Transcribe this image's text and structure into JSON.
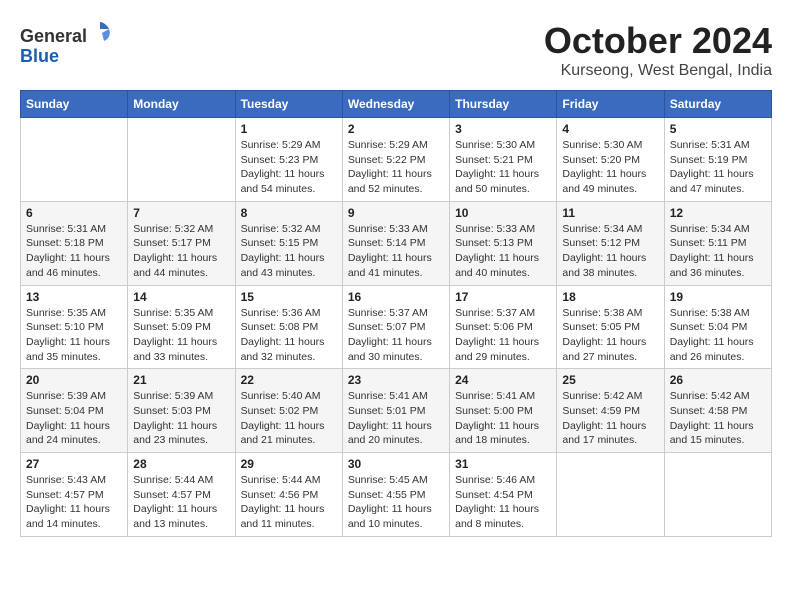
{
  "header": {
    "logo_line1": "General",
    "logo_line2": "Blue",
    "month_title": "October 2024",
    "location": "Kurseong, West Bengal, India"
  },
  "days_of_week": [
    "Sunday",
    "Monday",
    "Tuesday",
    "Wednesday",
    "Thursday",
    "Friday",
    "Saturday"
  ],
  "weeks": [
    [
      {
        "day": "",
        "sunrise": "",
        "sunset": "",
        "daylight": ""
      },
      {
        "day": "",
        "sunrise": "",
        "sunset": "",
        "daylight": ""
      },
      {
        "day": "1",
        "sunrise": "Sunrise: 5:29 AM",
        "sunset": "Sunset: 5:23 PM",
        "daylight": "Daylight: 11 hours and 54 minutes."
      },
      {
        "day": "2",
        "sunrise": "Sunrise: 5:29 AM",
        "sunset": "Sunset: 5:22 PM",
        "daylight": "Daylight: 11 hours and 52 minutes."
      },
      {
        "day": "3",
        "sunrise": "Sunrise: 5:30 AM",
        "sunset": "Sunset: 5:21 PM",
        "daylight": "Daylight: 11 hours and 50 minutes."
      },
      {
        "day": "4",
        "sunrise": "Sunrise: 5:30 AM",
        "sunset": "Sunset: 5:20 PM",
        "daylight": "Daylight: 11 hours and 49 minutes."
      },
      {
        "day": "5",
        "sunrise": "Sunrise: 5:31 AM",
        "sunset": "Sunset: 5:19 PM",
        "daylight": "Daylight: 11 hours and 47 minutes."
      }
    ],
    [
      {
        "day": "6",
        "sunrise": "Sunrise: 5:31 AM",
        "sunset": "Sunset: 5:18 PM",
        "daylight": "Daylight: 11 hours and 46 minutes."
      },
      {
        "day": "7",
        "sunrise": "Sunrise: 5:32 AM",
        "sunset": "Sunset: 5:17 PM",
        "daylight": "Daylight: 11 hours and 44 minutes."
      },
      {
        "day": "8",
        "sunrise": "Sunrise: 5:32 AM",
        "sunset": "Sunset: 5:15 PM",
        "daylight": "Daylight: 11 hours and 43 minutes."
      },
      {
        "day": "9",
        "sunrise": "Sunrise: 5:33 AM",
        "sunset": "Sunset: 5:14 PM",
        "daylight": "Daylight: 11 hours and 41 minutes."
      },
      {
        "day": "10",
        "sunrise": "Sunrise: 5:33 AM",
        "sunset": "Sunset: 5:13 PM",
        "daylight": "Daylight: 11 hours and 40 minutes."
      },
      {
        "day": "11",
        "sunrise": "Sunrise: 5:34 AM",
        "sunset": "Sunset: 5:12 PM",
        "daylight": "Daylight: 11 hours and 38 minutes."
      },
      {
        "day": "12",
        "sunrise": "Sunrise: 5:34 AM",
        "sunset": "Sunset: 5:11 PM",
        "daylight": "Daylight: 11 hours and 36 minutes."
      }
    ],
    [
      {
        "day": "13",
        "sunrise": "Sunrise: 5:35 AM",
        "sunset": "Sunset: 5:10 PM",
        "daylight": "Daylight: 11 hours and 35 minutes."
      },
      {
        "day": "14",
        "sunrise": "Sunrise: 5:35 AM",
        "sunset": "Sunset: 5:09 PM",
        "daylight": "Daylight: 11 hours and 33 minutes."
      },
      {
        "day": "15",
        "sunrise": "Sunrise: 5:36 AM",
        "sunset": "Sunset: 5:08 PM",
        "daylight": "Daylight: 11 hours and 32 minutes."
      },
      {
        "day": "16",
        "sunrise": "Sunrise: 5:37 AM",
        "sunset": "Sunset: 5:07 PM",
        "daylight": "Daylight: 11 hours and 30 minutes."
      },
      {
        "day": "17",
        "sunrise": "Sunrise: 5:37 AM",
        "sunset": "Sunset: 5:06 PM",
        "daylight": "Daylight: 11 hours and 29 minutes."
      },
      {
        "day": "18",
        "sunrise": "Sunrise: 5:38 AM",
        "sunset": "Sunset: 5:05 PM",
        "daylight": "Daylight: 11 hours and 27 minutes."
      },
      {
        "day": "19",
        "sunrise": "Sunrise: 5:38 AM",
        "sunset": "Sunset: 5:04 PM",
        "daylight": "Daylight: 11 hours and 26 minutes."
      }
    ],
    [
      {
        "day": "20",
        "sunrise": "Sunrise: 5:39 AM",
        "sunset": "Sunset: 5:04 PM",
        "daylight": "Daylight: 11 hours and 24 minutes."
      },
      {
        "day": "21",
        "sunrise": "Sunrise: 5:39 AM",
        "sunset": "Sunset: 5:03 PM",
        "daylight": "Daylight: 11 hours and 23 minutes."
      },
      {
        "day": "22",
        "sunrise": "Sunrise: 5:40 AM",
        "sunset": "Sunset: 5:02 PM",
        "daylight": "Daylight: 11 hours and 21 minutes."
      },
      {
        "day": "23",
        "sunrise": "Sunrise: 5:41 AM",
        "sunset": "Sunset: 5:01 PM",
        "daylight": "Daylight: 11 hours and 20 minutes."
      },
      {
        "day": "24",
        "sunrise": "Sunrise: 5:41 AM",
        "sunset": "Sunset: 5:00 PM",
        "daylight": "Daylight: 11 hours and 18 minutes."
      },
      {
        "day": "25",
        "sunrise": "Sunrise: 5:42 AM",
        "sunset": "Sunset: 4:59 PM",
        "daylight": "Daylight: 11 hours and 17 minutes."
      },
      {
        "day": "26",
        "sunrise": "Sunrise: 5:42 AM",
        "sunset": "Sunset: 4:58 PM",
        "daylight": "Daylight: 11 hours and 15 minutes."
      }
    ],
    [
      {
        "day": "27",
        "sunrise": "Sunrise: 5:43 AM",
        "sunset": "Sunset: 4:57 PM",
        "daylight": "Daylight: 11 hours and 14 minutes."
      },
      {
        "day": "28",
        "sunrise": "Sunrise: 5:44 AM",
        "sunset": "Sunset: 4:57 PM",
        "daylight": "Daylight: 11 hours and 13 minutes."
      },
      {
        "day": "29",
        "sunrise": "Sunrise: 5:44 AM",
        "sunset": "Sunset: 4:56 PM",
        "daylight": "Daylight: 11 hours and 11 minutes."
      },
      {
        "day": "30",
        "sunrise": "Sunrise: 5:45 AM",
        "sunset": "Sunset: 4:55 PM",
        "daylight": "Daylight: 11 hours and 10 minutes."
      },
      {
        "day": "31",
        "sunrise": "Sunrise: 5:46 AM",
        "sunset": "Sunset: 4:54 PM",
        "daylight": "Daylight: 11 hours and 8 minutes."
      },
      {
        "day": "",
        "sunrise": "",
        "sunset": "",
        "daylight": ""
      },
      {
        "day": "",
        "sunrise": "",
        "sunset": "",
        "daylight": ""
      }
    ]
  ]
}
